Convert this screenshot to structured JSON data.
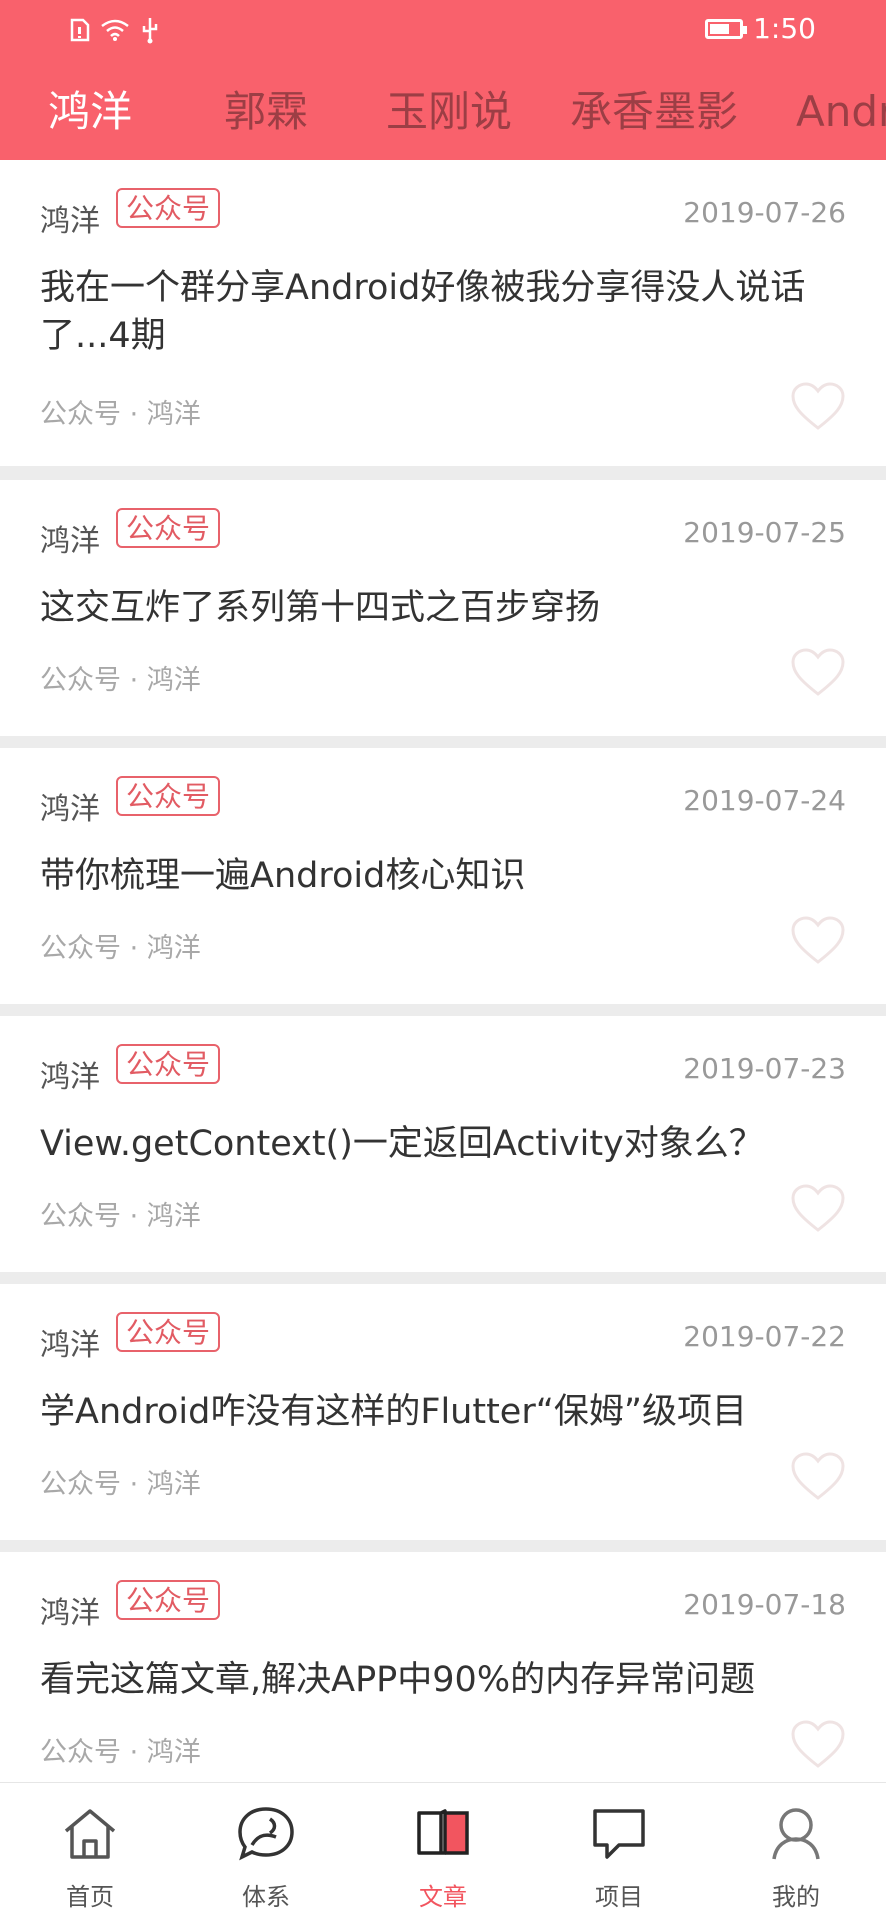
{
  "status_bar": {
    "time": "1:50"
  },
  "tabs": [
    {
      "label": "鸿洋",
      "active": true
    },
    {
      "label": "郭霖",
      "active": false
    },
    {
      "label": "玉刚说",
      "active": false
    },
    {
      "label": "承香墨影",
      "active": false
    },
    {
      "label": "Andro",
      "active": false
    }
  ],
  "articles": [
    {
      "author": "鸿洋",
      "tag": "公众号",
      "date": "2019-07-26",
      "title": "我在一个群分享Android好像被我分享得没人说话了...4期",
      "meta": "公众号 · 鸿洋"
    },
    {
      "author": "鸿洋",
      "tag": "公众号",
      "date": "2019-07-25",
      "title": "这交互炸了系列第十四式之百步穿扬",
      "meta": "公众号 · 鸿洋"
    },
    {
      "author": "鸿洋",
      "tag": "公众号",
      "date": "2019-07-24",
      "title": "带你梳理一遍Android核心知识",
      "meta": "公众号 · 鸿洋"
    },
    {
      "author": "鸿洋",
      "tag": "公众号",
      "date": "2019-07-23",
      "title": "View.getContext()一定返回Activity对象么？",
      "meta": "公众号 · 鸿洋"
    },
    {
      "author": "鸿洋",
      "tag": "公众号",
      "date": "2019-07-22",
      "title": "学Android咋没有这样的Flutter“保姆”级项目",
      "meta": "公众号 · 鸿洋"
    },
    {
      "author": "鸿洋",
      "tag": "公众号",
      "date": "2019-07-18",
      "title": "看完这篇文章,解决APP中90%的内存异常问题",
      "meta": "公众号 · 鸿洋"
    }
  ],
  "bottom_nav": [
    {
      "label": "首页",
      "icon": "home-icon",
      "active": false
    },
    {
      "label": "体系",
      "icon": "chat-bubble-icon",
      "active": false
    },
    {
      "label": "文章",
      "icon": "book-icon",
      "active": true
    },
    {
      "label": "项目",
      "icon": "message-icon",
      "active": false
    },
    {
      "label": "我的",
      "icon": "person-icon",
      "active": false
    }
  ],
  "colors": {
    "accent": "#f9616c",
    "tag": "#e25b63",
    "heart": "#f0e6e6"
  }
}
